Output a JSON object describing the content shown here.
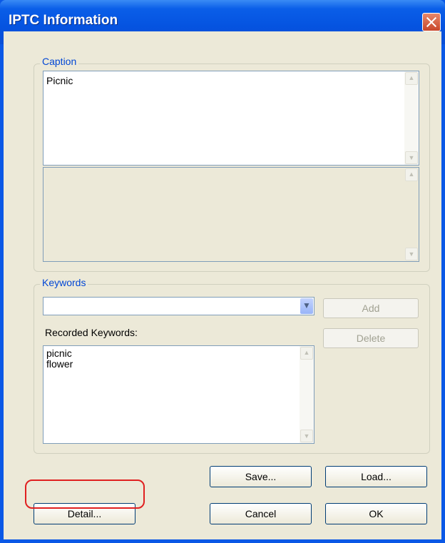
{
  "window": {
    "title": "IPTC Information"
  },
  "caption": {
    "legend": "Caption",
    "value": "Picnic"
  },
  "keywords": {
    "legend": "Keywords",
    "input_value": "",
    "add_label": "Add",
    "delete_label": "Delete",
    "recorded_label": "Recorded Keywords:",
    "recorded": [
      "picnic",
      "flower"
    ]
  },
  "buttons": {
    "save_label": "Save...",
    "load_label": "Load...",
    "detail_label": "Detail...",
    "cancel_label": "Cancel",
    "ok_label": "OK"
  },
  "icons": {
    "close": "close-icon",
    "scroll_up": "chevron-up-icon",
    "scroll_down": "chevron-down-icon",
    "dropdown": "chevron-down-icon"
  },
  "colors": {
    "highlight": "#e02020",
    "title_bar": "#0553e0",
    "face": "#ece9d8"
  }
}
